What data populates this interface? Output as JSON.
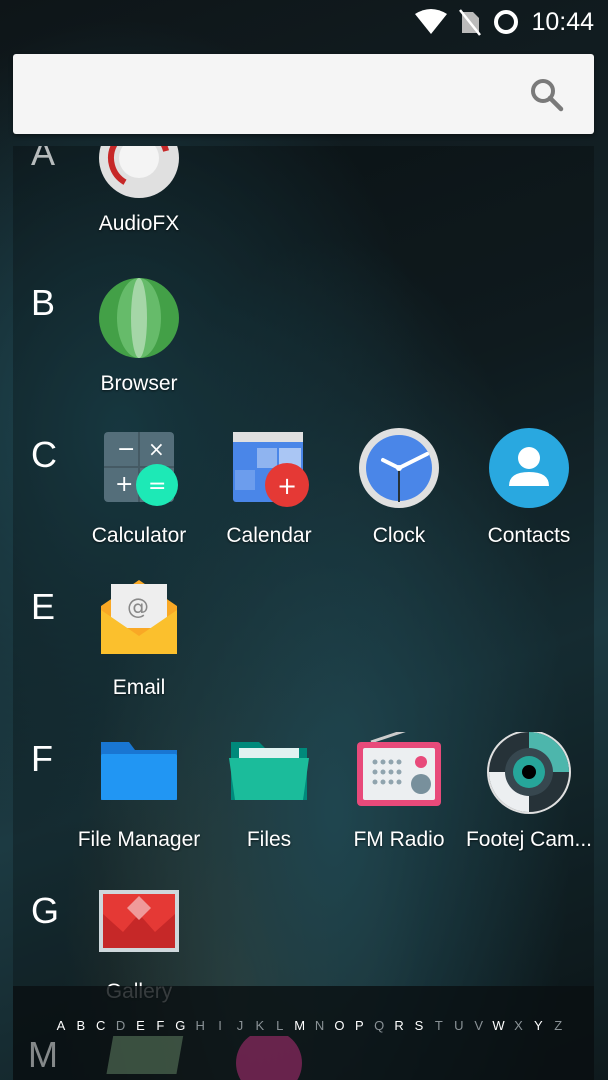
{
  "status_bar": {
    "time": "10:44",
    "icons": [
      "wifi-icon",
      "no-sim-icon",
      "circle-icon"
    ]
  },
  "search": {
    "placeholder": "",
    "icon": "search-icon"
  },
  "sections": [
    {
      "letter": "A",
      "apps": [
        {
          "label": "AudioFX",
          "icon": "audiofx-icon"
        }
      ]
    },
    {
      "letter": "B",
      "apps": [
        {
          "label": "Browser",
          "icon": "browser-icon"
        }
      ]
    },
    {
      "letter": "C",
      "apps": [
        {
          "label": "Calculator",
          "icon": "calculator-icon"
        },
        {
          "label": "Calendar",
          "icon": "calendar-icon"
        },
        {
          "label": "Clock",
          "icon": "clock-icon"
        },
        {
          "label": "Contacts",
          "icon": "contacts-icon"
        }
      ]
    },
    {
      "letter": "E",
      "apps": [
        {
          "label": "Email",
          "icon": "email-icon"
        }
      ]
    },
    {
      "letter": "F",
      "apps": [
        {
          "label": "File Manager",
          "icon": "file-manager-icon"
        },
        {
          "label": "Files",
          "icon": "files-icon"
        },
        {
          "label": "FM Radio",
          "icon": "fm-radio-icon"
        },
        {
          "label": "Footej Cam...",
          "icon": "footej-camera-icon"
        }
      ]
    },
    {
      "letter": "G",
      "apps": [
        {
          "label": "Gallery",
          "icon": "gallery-icon"
        }
      ]
    },
    {
      "letter": "M",
      "apps": []
    }
  ],
  "fast_scroller": {
    "letters": [
      {
        "ch": "A",
        "active": true
      },
      {
        "ch": "B",
        "active": true
      },
      {
        "ch": "C",
        "active": true
      },
      {
        "ch": "D",
        "active": false
      },
      {
        "ch": "E",
        "active": true
      },
      {
        "ch": "F",
        "active": true
      },
      {
        "ch": "G",
        "active": true
      },
      {
        "ch": "H",
        "active": false
      },
      {
        "ch": "I",
        "active": false
      },
      {
        "ch": "J",
        "active": false
      },
      {
        "ch": "K",
        "active": false
      },
      {
        "ch": "L",
        "active": false
      },
      {
        "ch": "M",
        "active": true
      },
      {
        "ch": "N",
        "active": false
      },
      {
        "ch": "O",
        "active": true
      },
      {
        "ch": "P",
        "active": true
      },
      {
        "ch": "Q",
        "active": false
      },
      {
        "ch": "R",
        "active": true
      },
      {
        "ch": "S",
        "active": true
      },
      {
        "ch": "T",
        "active": false
      },
      {
        "ch": "U",
        "active": false
      },
      {
        "ch": "V",
        "active": false
      },
      {
        "ch": "W",
        "active": true
      },
      {
        "ch": "X",
        "active": false
      },
      {
        "ch": "Y",
        "active": true
      },
      {
        "ch": "Z",
        "active": false
      }
    ]
  },
  "colors": {
    "accent_blue": "#4a86e8",
    "contacts_blue": "#29a8e0",
    "calculator_green": "#1de9b6",
    "calendar_red": "#e53935",
    "email_yellow": "#fbc02d",
    "folder_blue": "#2196f3",
    "folder_teal": "#1bbc9b",
    "radio_pink": "#e84a7a"
  }
}
